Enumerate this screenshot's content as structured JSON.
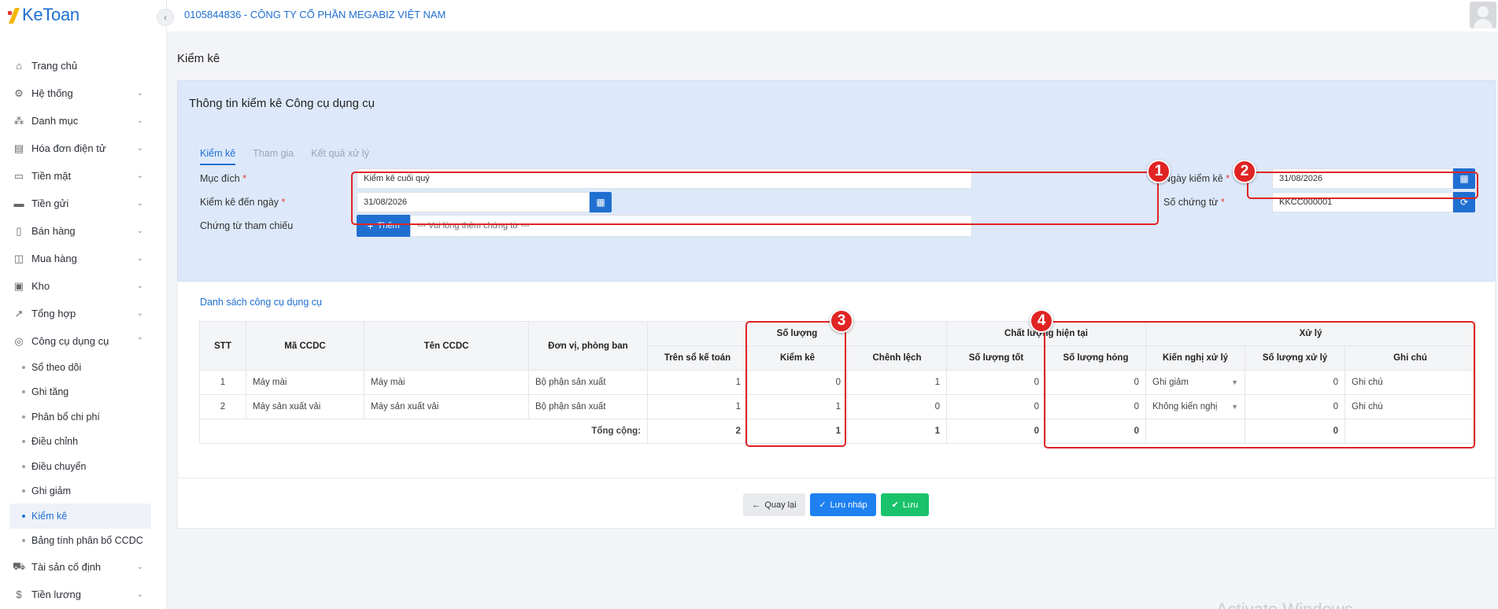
{
  "app": {
    "logo_text": "KeToan"
  },
  "header": {
    "company": "0105844836 - CÔNG TY CỔ PHẦN MEGABIZ VIỆT NAM"
  },
  "sidebar": {
    "items": [
      {
        "label": "Trang chủ",
        "icon": "home-icon"
      },
      {
        "label": "Hệ thống",
        "icon": "gear-icon"
      },
      {
        "label": "Danh mục",
        "icon": "grid-icon"
      },
      {
        "label": "Hóa đơn điện tử",
        "icon": "invoice-icon"
      },
      {
        "label": "Tiền mặt",
        "icon": "cash-icon"
      },
      {
        "label": "Tiền gửi",
        "icon": "bank-icon"
      },
      {
        "label": "Bán hàng",
        "icon": "sales-icon"
      },
      {
        "label": "Mua hàng",
        "icon": "cart-icon"
      },
      {
        "label": "Kho",
        "icon": "warehouse-icon"
      },
      {
        "label": "Tổng hợp",
        "icon": "chart-icon"
      },
      {
        "label": "Công cụ dụng cụ",
        "icon": "tools-icon"
      }
    ],
    "sub_items": [
      {
        "label": "Sổ theo dõi"
      },
      {
        "label": "Ghi tăng"
      },
      {
        "label": "Phân bổ chi phí"
      },
      {
        "label": "Điều chỉnh"
      },
      {
        "label": "Điều chuyển"
      },
      {
        "label": "Ghi giảm"
      },
      {
        "label": "Kiểm kê"
      },
      {
        "label": "Bảng tính phân bổ CCDC"
      }
    ],
    "after_items": [
      {
        "label": "Tài sản cố định",
        "icon": "asset-icon"
      },
      {
        "label": "Tiền lương",
        "icon": "salary-icon"
      }
    ]
  },
  "page": {
    "title": "Kiểm kê"
  },
  "info": {
    "title": "Thông tin kiểm kê Công cụ dụng cụ",
    "tabs": [
      "Kiểm kê",
      "Tham gia",
      "Kết quả xử lý"
    ],
    "purpose_label": "Mục đích",
    "purpose_value": "Kiểm kê cuối quý",
    "to_date_label": "Kiểm kê đến ngày",
    "to_date_value": "31/08/2026",
    "ref_label": "Chứng từ tham chiếu",
    "ref_add": "Thêm",
    "ref_placeholder": "--- Vui lòng thêm chứng từ ---",
    "check_date_label": "Ngày kiểm kê",
    "check_date_value": "31/08/2026",
    "voucher_label": "Số chứng từ",
    "voucher_value": "KKCC000001",
    "required_mark": "*"
  },
  "table": {
    "title": "Danh sách công cụ dụng cụ",
    "headers": {
      "stt": "STT",
      "code": "Mã CCDC",
      "name": "Tên CCDC",
      "dept": "Đơn vị, phòng ban",
      "qty_group": "Số lượng",
      "quality_group": "Chất lượng hiện tại",
      "process_group": "Xử lý",
      "book": "Trên sổ kế toán",
      "counted": "Kiểm kê",
      "diff": "Chênh lệch",
      "good": "Số lượng tốt",
      "broken": "Số lượng hỏng",
      "recommend": "Kiến nghị xử lý",
      "processed": "Số lượng xử lý",
      "note": "Ghi chú"
    },
    "rows": [
      {
        "stt": "1",
        "code": "Máy mài",
        "name": "Máy mài",
        "dept": "Bộ phận sản xuất",
        "book": "1",
        "counted": "0",
        "diff": "1",
        "good": "0",
        "broken": "0",
        "recommend": "Ghi giảm",
        "processed": "0",
        "note": "Ghi chú"
      },
      {
        "stt": "2",
        "code": "Máy sản xuất vải",
        "name": "Máy sản xuất vải",
        "dept": "Bộ phận sản xuất",
        "book": "1",
        "counted": "1",
        "diff": "0",
        "good": "0",
        "broken": "0",
        "recommend": "Không kiến nghị",
        "processed": "0",
        "note": "Ghi chú"
      }
    ],
    "total": {
      "label": "Tổng cộng:",
      "book": "2",
      "counted": "1",
      "diff": "1",
      "good": "0",
      "broken": "0",
      "processed": "0"
    }
  },
  "actions": {
    "back": "Quay lại",
    "draft": "Lưu nháp",
    "save": "Lưu"
  },
  "annotations": [
    "1",
    "2",
    "3",
    "4"
  ],
  "watermark": "Activate Windows",
  "colors": {
    "primary": "#1f6fd1",
    "success": "#19c26b",
    "annotation": "#e02424",
    "panel": "#dde9fb"
  }
}
